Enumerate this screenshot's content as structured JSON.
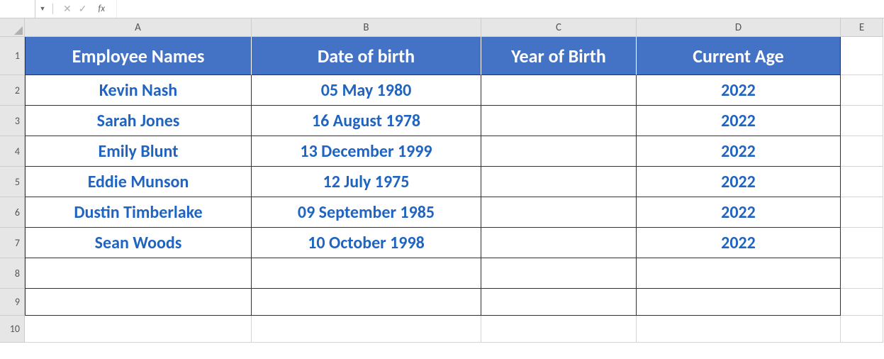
{
  "formula_bar": {
    "name_box": "",
    "cancel_icon": "✕",
    "enter_icon": "✓",
    "fx_label": "fx",
    "formula": ""
  },
  "columns": [
    "A",
    "B",
    "C",
    "D",
    "E"
  ],
  "row_numbers": [
    "1",
    "2",
    "3",
    "4",
    "5",
    "6",
    "7",
    "8",
    "9",
    "10"
  ],
  "headers": {
    "A": "Employee Names",
    "B": "Date of birth",
    "C": "Year of Birth",
    "D": "Current Age"
  },
  "rows": [
    {
      "A": "Kevin Nash",
      "B": "05 May 1980",
      "C": "",
      "D": "2022"
    },
    {
      "A": "Sarah Jones",
      "B": "16 August 1978",
      "C": "",
      "D": "2022"
    },
    {
      "A": "Emily Blunt",
      "B": "13 December 1999",
      "C": "",
      "D": "2022"
    },
    {
      "A": "Eddie Munson",
      "B": "12 July 1975",
      "C": "",
      "D": "2022"
    },
    {
      "A": "Dustin Timberlake",
      "B": "09 September 1985",
      "C": "",
      "D": "2022"
    },
    {
      "A": "Sean Woods",
      "B": "10 October 1998",
      "C": "",
      "D": "2022"
    }
  ],
  "chart_data": {
    "type": "table",
    "title": "",
    "columns": [
      "Employee Names",
      "Date of birth",
      "Year of Birth",
      "Current Age"
    ],
    "data": [
      [
        "Kevin Nash",
        "05 May 1980",
        "",
        "2022"
      ],
      [
        "Sarah Jones",
        "16 August 1978",
        "",
        "2022"
      ],
      [
        "Emily Blunt",
        "13 December 1999",
        "",
        "2022"
      ],
      [
        "Eddie Munson",
        "12 July 1975",
        "",
        "2022"
      ],
      [
        "Dustin Timberlake",
        "09 September 1985",
        "",
        "2022"
      ],
      [
        "Sean Woods",
        "10 October 1998",
        "",
        "2022"
      ]
    ]
  }
}
